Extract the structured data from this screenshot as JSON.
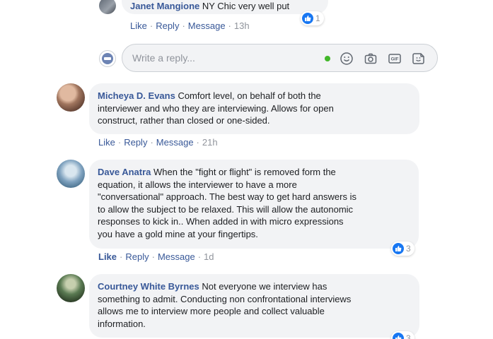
{
  "top_reply": {
    "author": "Janet Mangione",
    "text": " NY Chic very well put",
    "actions": {
      "like": "Like",
      "reply": "Reply",
      "message": "Message",
      "time": "13h"
    },
    "reaction_count": "1"
  },
  "reply_composer": {
    "placeholder": "Write a reply...",
    "icons": [
      "emoji-icon",
      "camera-icon",
      "gif-icon",
      "sticker-icon"
    ]
  },
  "comments": [
    {
      "author": "Micheya D. Evans",
      "lines": [
        " Comfort level, on behalf of both the",
        "interviewer and who they are interviewing. Allows for open",
        "construct, rather than closed or one-sided."
      ],
      "actions": {
        "like": "Like",
        "reply": "Reply",
        "message": "Message",
        "time": "21h"
      }
    },
    {
      "author": "Dave Anatra",
      "lines": [
        " When the \"fight or flight\" is removed form the",
        "equation, it allows the interviewer to have a more",
        "\"conversational\" approach. The best way to get hard answers is",
        "to allow the subject to be relaxed. This will allow the autonomic",
        "responses to kick in.. When added in with micro expressions",
        "you have a gold mine at your fingertips."
      ],
      "actions": {
        "like": "Like",
        "reply": "Reply",
        "message": "Message",
        "time": "1d"
      },
      "reaction_count": "3"
    },
    {
      "author": "Courtney White Byrnes",
      "lines": [
        " Not everyone we interview has",
        "something to admit. Conducting non confrontational interviews",
        "allows me to interview more people and collect valuable",
        "information."
      ],
      "reaction_count": "3"
    }
  ],
  "colors": {
    "link": "#385898",
    "bubble": "#f2f3f5",
    "like_blue": "#1877f2",
    "meta_gray": "#90949c"
  }
}
